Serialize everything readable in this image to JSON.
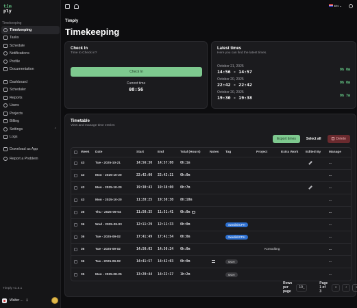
{
  "sidebar": {
    "logo_top": "tim",
    "logo_bottom": "ply",
    "section_label": "Timekeeping",
    "items": [
      {
        "label": "Timekeeping",
        "active": true
      },
      {
        "label": "Tasks"
      },
      {
        "label": "Schedule"
      },
      {
        "label": "Notifications"
      },
      {
        "label": "Profile"
      },
      {
        "label": "Documentation"
      }
    ],
    "admin_items": [
      {
        "label": "Dashboard"
      },
      {
        "label": "Scheduler"
      },
      {
        "label": "Reports"
      },
      {
        "label": "Users"
      },
      {
        "label": "Projects"
      },
      {
        "label": "Billing"
      },
      {
        "label": "Settings"
      },
      {
        "label": "Logs"
      }
    ],
    "extra_items": [
      {
        "label": "Download as App"
      },
      {
        "label": "Report a Problem"
      }
    ],
    "version": "Timply v1.5.1",
    "user_name": "Walter ..."
  },
  "topbar": {
    "language": "EN"
  },
  "header": {
    "brand": "Timply",
    "title": "Timekeeping"
  },
  "checkin": {
    "title": "Check In",
    "subtitle": "Time to Check in?",
    "button": "Check In",
    "current_label": "Current time",
    "current_time": "08:56"
  },
  "latest": {
    "title": "Latest times",
    "subtitle": "Here you can find the latest times.",
    "rows": [
      {
        "date": "October 21, 2025",
        "range": "14:56 - 14:57",
        "dur": "0h 0m"
      },
      {
        "date": "October 20, 2025",
        "range": "22:42 - 22:42",
        "dur": "0h 0m"
      },
      {
        "date": "October 20, 2025",
        "range": "19:30 - 19:38",
        "dur": "0h 7m"
      }
    ]
  },
  "timetable": {
    "title": "Timetable",
    "subtitle": "View and manage time entries",
    "export_label": "Export times",
    "select_all_label": "Select all",
    "delete_label": "Delete",
    "columns": [
      "Week",
      "Date",
      "Start",
      "End",
      "Total (Hours)",
      "Notes",
      "Tag",
      "Project",
      "Extra Work",
      "Edited By",
      "Manage"
    ],
    "rows": [
      {
        "week": "43",
        "date": "Tue - 2025-10-21",
        "start": "14:56:30",
        "end": "14:57:00",
        "total": "0h:1m",
        "notes": "",
        "tag": "",
        "project": "",
        "edited": true
      },
      {
        "week": "43",
        "date": "Mon - 2025-10-20",
        "start": "22:42:00",
        "end": "22:42:11",
        "total": "0h:0m",
        "notes": "",
        "tag": "",
        "project": "",
        "edited": false
      },
      {
        "week": "43",
        "date": "Mon - 2025-10-20",
        "start": "19:30:43",
        "end": "19:38:00",
        "total": "0h:7m",
        "notes": "",
        "tag": "",
        "project": "",
        "edited": true
      },
      {
        "week": "43",
        "date": "Mon - 2025-10-20",
        "start": "11:20:25",
        "end": "19:30:30",
        "total": "8h:10m",
        "notes": "",
        "tag": "",
        "project": "",
        "edited": false
      },
      {
        "week": "36",
        "date": "Thu - 2025-09-04",
        "start": "11:50:35",
        "end": "11:51:41",
        "total": "0h:0m",
        "notes": "comment",
        "tag": "",
        "project": "",
        "edited": false
      },
      {
        "week": "36",
        "date": "Wed - 2025-09-03",
        "start": "12:11:29",
        "end": "12:11:33",
        "total": "0h:0m",
        "notes": "",
        "tag": "SwedishCPH",
        "project": "",
        "edited": false
      },
      {
        "week": "36",
        "date": "Tue - 2025-09-02",
        "start": "17:41:49",
        "end": "17:41:54",
        "total": "0h:0m",
        "notes": "",
        "tag": "SwedishCPH",
        "project": "",
        "edited": false
      },
      {
        "week": "36",
        "date": "Tue - 2025-09-02",
        "start": "14:50:03",
        "end": "14:50:24",
        "total": "0h:0m",
        "notes": "",
        "tag": "",
        "project": "Konsulting",
        "edited": false
      },
      {
        "week": "36",
        "date": "Tue - 2025-09-02",
        "start": "14:41:57",
        "end": "14:42:03",
        "total": "0h:0m",
        "notes": "note",
        "tag": "OGH",
        "project": "",
        "edited": false
      },
      {
        "week": "35",
        "date": "Mon - 2025-08-25",
        "start": "13:20:44",
        "end": "14:22:17",
        "total": "1h:2m",
        "notes": "",
        "tag": "OGH",
        "project": "",
        "edited": false
      }
    ],
    "manage_label": "...",
    "rows_per_page_label": "Rows per page",
    "rows_per_page": "10",
    "page_label": "Page 1 of 3"
  },
  "colors": {
    "accent_green": "#7ec98f",
    "duration_green": "#66cc88",
    "tag_blue": "#2d6fcf",
    "delete_red": "#6a2a2e"
  }
}
